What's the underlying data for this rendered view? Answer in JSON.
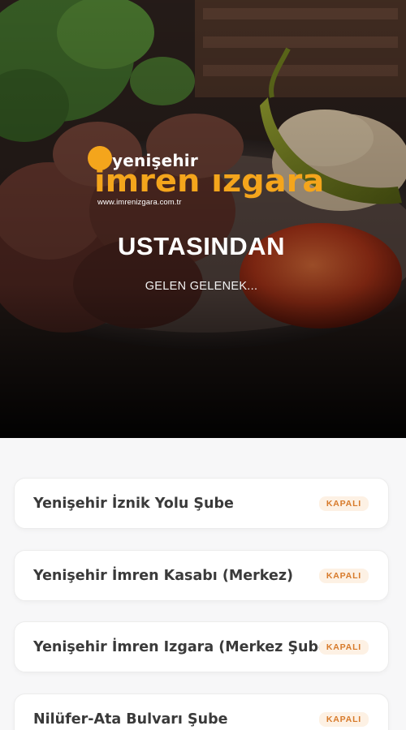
{
  "hero": {
    "logo": {
      "small_text": "yenişehir",
      "big_text": "imren ızgara",
      "url": "www.imrenizgara.com.tr"
    },
    "title": "USTASINDAN",
    "subtitle": "GELEN GELENEK..."
  },
  "branches": [
    {
      "name": "Yenişehir İznik Yolu Şube",
      "status": "KAPALI"
    },
    {
      "name": "Yenişehir İmren Kasabı (Merkez)",
      "status": "KAPALI"
    },
    {
      "name": "Yenişehir İmren Izgara (Merkez Şube)",
      "status": "KAPALI"
    },
    {
      "name": "Nilüfer-Ata Bulvarı Şube",
      "status": "KAPALI"
    }
  ],
  "colors": {
    "brand_orange": "#f4a51c",
    "status_closed_text": "#d77a2a",
    "status_closed_bg": "#fdf1e4"
  }
}
